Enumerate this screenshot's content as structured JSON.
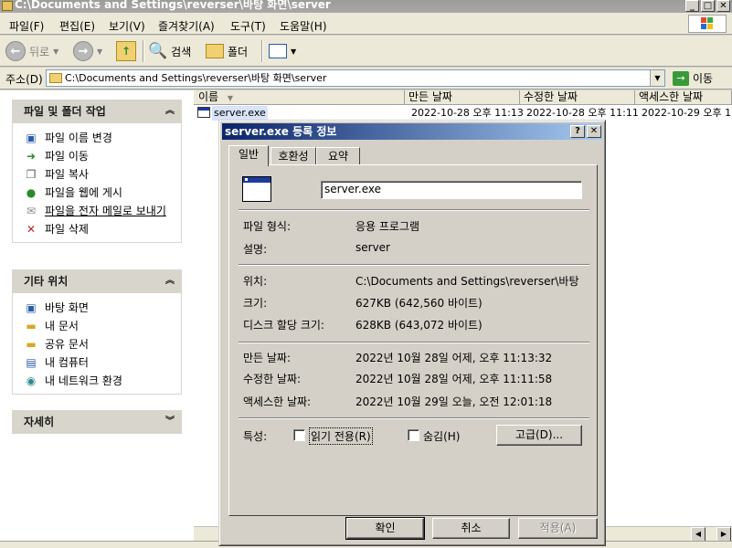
{
  "window": {
    "title": "C:\\Documents and Settings\\reverser\\바탕 화면\\server"
  },
  "menu": [
    "파일(F)",
    "편집(E)",
    "보기(V)",
    "즐겨찾기(A)",
    "도구(T)",
    "도움말(H)"
  ],
  "toolbar": {
    "back": "뒤로",
    "search": "검색",
    "folders": "폴더"
  },
  "address": {
    "label": "주소(D)",
    "value": "C:\\Documents and Settings\\reverser\\바탕 화면\\server",
    "go": "이동"
  },
  "left_panels": {
    "tasks": {
      "title": "파일 및 폴더 작업",
      "items": [
        "파일 이름 변경",
        "파일 이동",
        "파일 복사",
        "파일을 웹에 게시",
        "파일을 전자 메일로 보내기",
        "파일 삭제"
      ]
    },
    "places": {
      "title": "기타 위치",
      "items": [
        "바탕 화면",
        "내 문서",
        "공유 문서",
        "내 컴퓨터",
        "내 네트워크 환경"
      ]
    },
    "details": {
      "title": "자세히"
    }
  },
  "file_list": {
    "columns": [
      "이름",
      "만든 날짜",
      "수정한 날짜",
      "액세스한 날짜"
    ],
    "rows": [
      {
        "name": "server.exe",
        "created": "2022-10-28 오후 11:13",
        "modified": "2022-10-28 오후 11:11",
        "accessed": "2022-10-29 오후 1"
      }
    ]
  },
  "dialog": {
    "title": "server.exe 등록 정보",
    "tabs": [
      "일반",
      "호환성",
      "요약"
    ],
    "filename": "server.exe",
    "fields": {
      "type_label": "파일 형식:",
      "type_value": "응용 프로그램",
      "desc_label": "설명:",
      "desc_value": "server",
      "location_label": "위치:",
      "location_value": "C:\\Documents and Settings\\reverser\\바탕",
      "size_label": "크기:",
      "size_value": "627KB (642,560 바이트)",
      "disk_label": "디스크 할당 크기:",
      "disk_value": "628KB (643,072 바이트)",
      "created_label": "만든 날짜:",
      "created_value": "2022년 10월 28일 어제, 오후 11:13:32",
      "modified_label": "수정한 날짜:",
      "modified_value": "2022년 10월 28일 어제, 오후 11:11:58",
      "accessed_label": "액세스한 날짜:",
      "accessed_value": "2022년 10월 29일 오늘, 오전 12:01:18"
    },
    "attributes": {
      "label": "특성:",
      "readonly": "읽기 전용(R)",
      "hidden": "숨김(H)",
      "advanced": "고급(D)..."
    },
    "buttons": {
      "ok": "확인",
      "cancel": "취소",
      "apply": "적용(A)"
    }
  }
}
